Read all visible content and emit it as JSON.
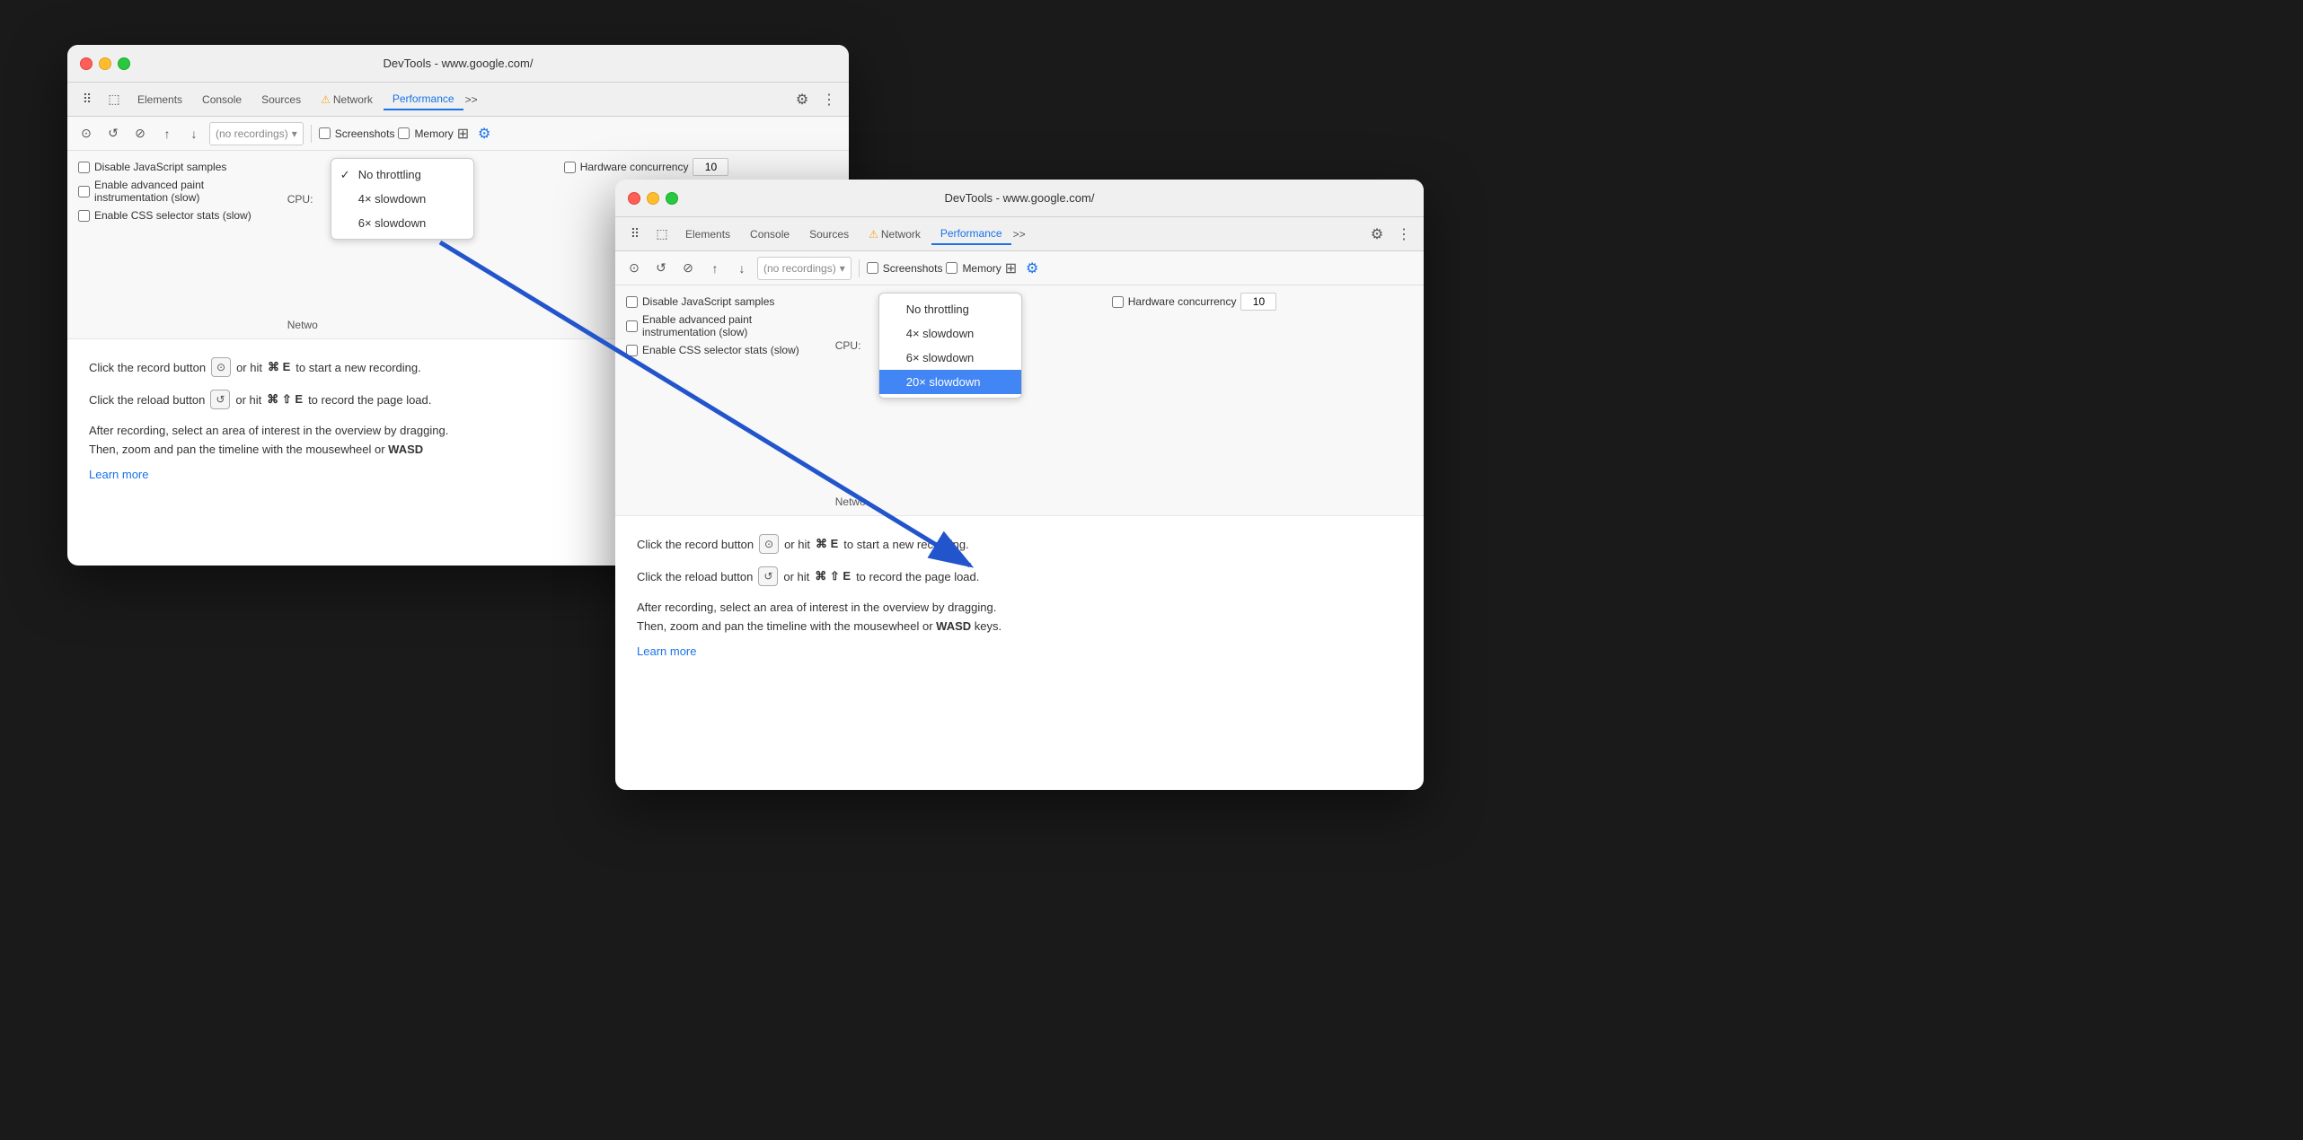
{
  "window1": {
    "title": "DevTools - www.google.com/",
    "tabs": [
      "Elements",
      "Console",
      "Sources",
      "Network",
      "Performance",
      ">>"
    ],
    "recordings_placeholder": "(no recordings)",
    "checkboxes": [
      {
        "label": "Disable JavaScript samples"
      },
      {
        "label": "Enable advanced paint instrumentation (slow)"
      },
      {
        "label": "Enable CSS selector stats (slow)"
      }
    ],
    "cpu_label": "CPU:",
    "network_label": "Netwo",
    "hw_label": "Hardware concurrency",
    "hw_value": "10",
    "screenshots_label": "Screenshots",
    "memory_label": "Memory",
    "dropdown": {
      "items": [
        {
          "label": "No throttling",
          "checked": true
        },
        {
          "label": "4× slowdown"
        },
        {
          "label": "6× slowdown"
        }
      ]
    },
    "instructions": [
      "Click the record button  or hit ⌘ E to start a new recording.",
      "Click the reload button  or hit ⌘ ⇧ E to record the page load."
    ],
    "description": "After recording, select an area of interest in the overview by dragging.\nThen, zoom and pan the timeline with the mousewheel or WASD",
    "learn_more": "Learn more"
  },
  "window2": {
    "title": "DevTools - www.google.com/",
    "tabs": [
      "Elements",
      "Console",
      "Sources",
      "Network",
      "Performance",
      ">>"
    ],
    "recordings_placeholder": "(no recordings)",
    "checkboxes": [
      {
        "label": "Disable JavaScript samples"
      },
      {
        "label": "Enable advanced paint instrumentation (slow)"
      },
      {
        "label": "Enable CSS selector stats (slow)"
      }
    ],
    "cpu_label": "CPU:",
    "network_label": "Netwo",
    "hw_label": "Hardware concurrency",
    "hw_value": "10",
    "screenshots_label": "Screenshots",
    "memory_label": "Memory",
    "dropdown": {
      "items": [
        {
          "label": "No throttling"
        },
        {
          "label": "4× slowdown"
        },
        {
          "label": "6× slowdown"
        },
        {
          "label": "20× slowdown",
          "highlighted": true
        }
      ]
    },
    "instructions": [
      "Click the record button  or hit ⌘ E to start a new recording.",
      "Click the reload button  or hit ⌘ ⇧ E to record the page load."
    ],
    "description": "After recording, select an area of interest in the overview by dragging.\nThen, zoom and pan the timeline with the mousewheel or WASD keys.",
    "learn_more": "Learn more"
  }
}
